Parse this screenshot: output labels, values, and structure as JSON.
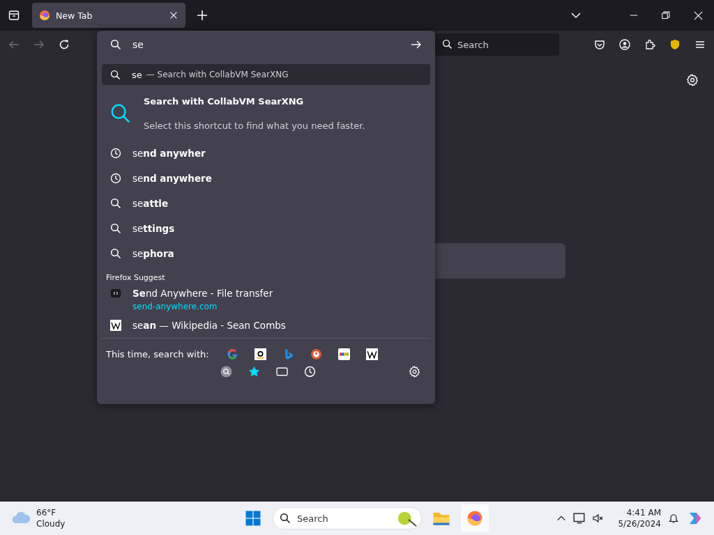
{
  "tabs": [
    {
      "title": "New Tab",
      "selected": true
    }
  ],
  "urlbar": {
    "value": "se"
  },
  "search_field": {
    "placeholder": "Search"
  },
  "dropdown": {
    "first_row": {
      "query": "se",
      "action": "— Search with CollabVM SearXNG",
      "selected": true
    },
    "shortcut": {
      "title": "Search with CollabVM SearXNG",
      "subtitle": "Select this shortcut to find what you need faster."
    },
    "suggestions": [
      {
        "kind": "history",
        "text": "se**nd anywher**"
      },
      {
        "kind": "history",
        "text": "se**nd anywhere**"
      },
      {
        "kind": "search",
        "text": "se**attle**"
      },
      {
        "kind": "search",
        "text": "se**ttings**"
      },
      {
        "kind": "search",
        "text": "se**phora**"
      }
    ],
    "section_label": "Firefox Suggest",
    "results": [
      {
        "kind": "site",
        "title": "**Se**nd Anywhere - File transfer",
        "url": "send-anywhere.com"
      },
      {
        "kind": "wikipedia",
        "title": "se**an** — Wikipedia - Sean Combs"
      }
    ],
    "search_with_label": "This time, search with:"
  },
  "taskbar": {
    "weather": {
      "temperature": "66°F",
      "condition": "Cloudy"
    },
    "search_placeholder": "Search",
    "time": "4:41 AM",
    "date": "5/26/2024"
  }
}
